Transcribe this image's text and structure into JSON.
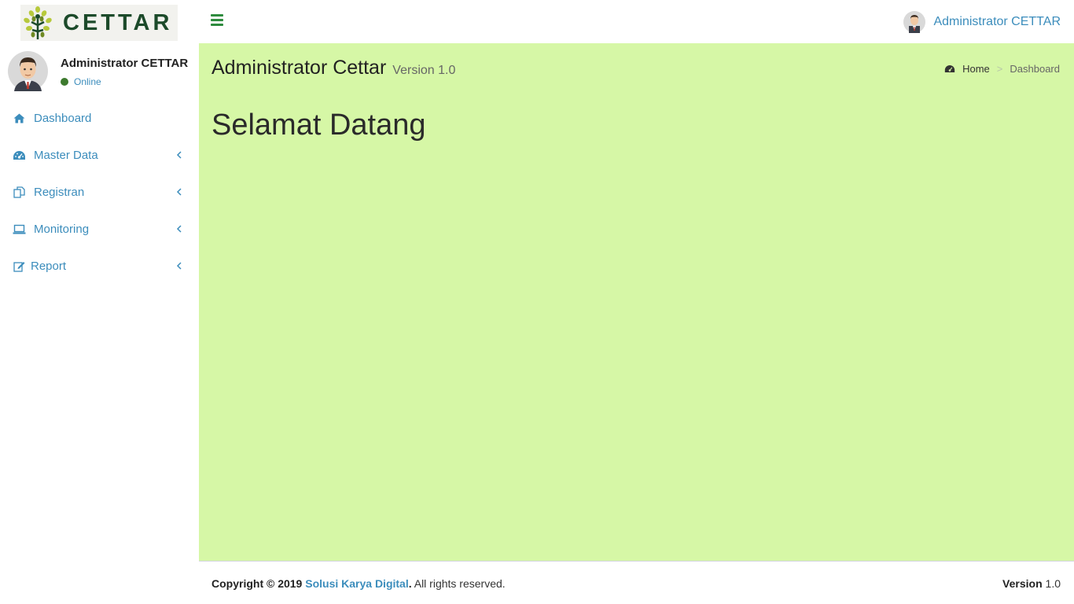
{
  "header": {
    "logo_text": "CETTAR",
    "user_name": "Administrator CETTAR"
  },
  "sidebar": {
    "user_name": "Administrator CETTAR",
    "status": "Online",
    "status_color": "#3d7a2e",
    "items": [
      {
        "label": "Dashboard",
        "icon": "home-icon",
        "has_submenu": false
      },
      {
        "label": "Master Data",
        "icon": "dashboard-gauge-icon",
        "has_submenu": true
      },
      {
        "label": "Registran",
        "icon": "copy-icon",
        "has_submenu": true
      },
      {
        "label": "Monitoring",
        "icon": "laptop-icon",
        "has_submenu": true
      },
      {
        "label": "Report",
        "icon": "edit-icon",
        "has_submenu": true
      }
    ]
  },
  "content": {
    "title": "Administrator Cettar",
    "subtitle": "Version 1.0",
    "breadcrumb": {
      "home": "Home",
      "current": "Dashboard"
    },
    "welcome": "Selamat Datang",
    "background": "#d6f7a6"
  },
  "footer": {
    "copyright_prefix": "Copyright © 2019",
    "company": "Solusi Karya Digital",
    "suffix": ". All rights reserved.",
    "version_label": "Version",
    "version_value": "1.0"
  },
  "colors": {
    "accent": "#3c8dbc",
    "brand_green": "#2e8b3e"
  }
}
